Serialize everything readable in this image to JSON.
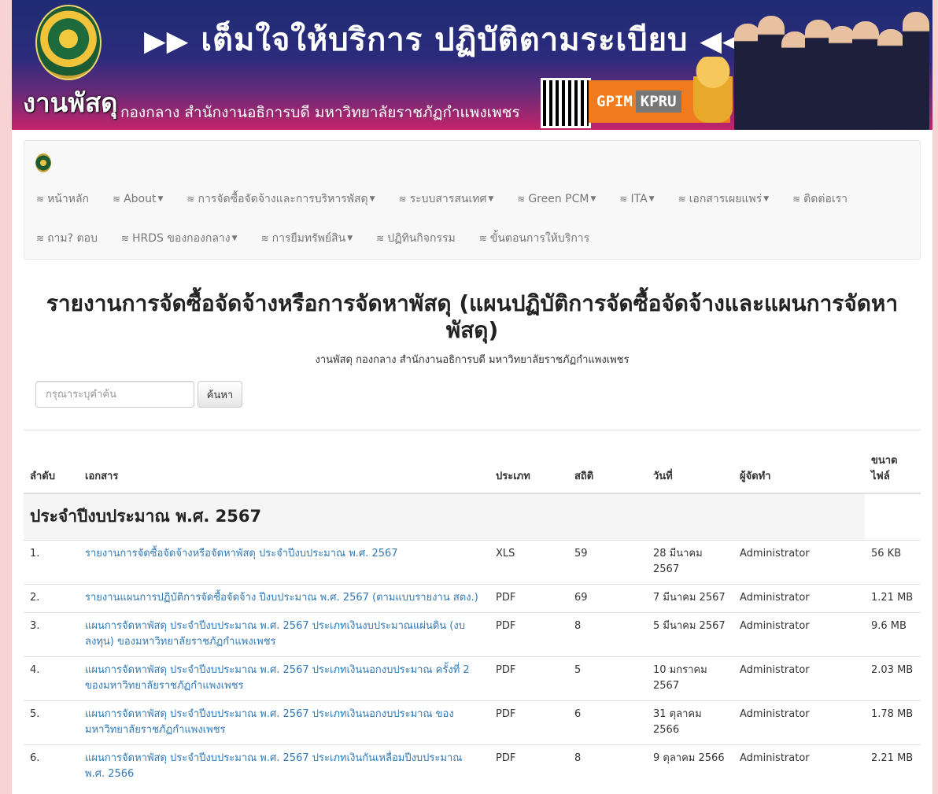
{
  "banner": {
    "slogan": "เต็มใจให้บริการ ปฏิบัติตามระเบียบ",
    "department": "งานพัสดุ",
    "organization": "กองกลาง สำนักงานอธิการบดี มหาวิทยาลัยราชภัฏกำแพงเพชร",
    "gpim_label": "GPIM",
    "kpru_label": "KPRU"
  },
  "nav": {
    "row1": [
      {
        "label": "หน้าหลัก",
        "dropdown": false
      },
      {
        "label": "About",
        "dropdown": true
      },
      {
        "label": "การจัดซื้อจัดจ้างและการบริหารพัสดุ",
        "dropdown": true
      },
      {
        "label": "ระบบสารสนเทศ",
        "dropdown": true
      },
      {
        "label": "Green PCM",
        "dropdown": true
      },
      {
        "label": "ITA",
        "dropdown": true
      },
      {
        "label": "เอกสารเผยแพร่",
        "dropdown": true
      },
      {
        "label": "ติดต่อเรา",
        "dropdown": false
      }
    ],
    "row2": [
      {
        "label": "ถาม? ตอบ",
        "dropdown": false
      },
      {
        "label": "HRDS ของกองกลาง",
        "dropdown": true
      },
      {
        "label": "การยืมทรัพย์สิน",
        "dropdown": true
      },
      {
        "label": "ปฏิทินกิจกรรม",
        "dropdown": false
      },
      {
        "label": "ขั้นตอนการให้บริการ",
        "dropdown": false
      }
    ]
  },
  "page": {
    "title": "รายงานการจัดซื้อจัดจ้างหรือการจัดหาพัสดุ (แผนปฏิบัติการจัดซื้อจัดจ้างและแผนการจัดหาพัสดุ)",
    "subtitle": "งานพัสดุ กองกลาง สำนักงานอธิการบดี มหาวิทยาลัยราชภัฏกำแพงเพชร"
  },
  "search": {
    "placeholder": "กรุณาระบุคำค้น",
    "button_label": "ค้นหา"
  },
  "table": {
    "headers": {
      "no": "ลำดับ",
      "doc": "เอกสาร",
      "type": "ประเภท",
      "stat": "สถิติ",
      "date": "วันที่",
      "author": "ผู้จัดทำ",
      "size": "ขนาดไฟล์"
    },
    "group_title": "ประจำปีงบประมาณ พ.ศ. 2567",
    "rows": [
      {
        "no": "1.",
        "doc": "รายงานการจัดซื้อจัดจ้างหรือจัดหาพัสดุ ประจำปีงบประมาณ พ.ศ. 2567",
        "type": "XLS",
        "stat": "59",
        "date": "28 มีนาคม 2567",
        "author": "Administrator",
        "size": "56 KB"
      },
      {
        "no": "2.",
        "doc": "รายงานแผนการปฏิบัติการจัดซื้อจัดจ้าง ปีงบประมาณ พ.ศ. 2567 (ตามแบบรายงาน สตง.)",
        "type": "PDF",
        "stat": "69",
        "date": "7 มีนาคม 2567",
        "author": "Administrator",
        "size": "1.21 MB"
      },
      {
        "no": "3.",
        "doc": "แผนการจัดหาพัสดุ ประจำปีงบประมาณ พ.ศ. 2567 ประเภทเงินงบประมาณแผ่นดิน (งบลงทุน) ของมหาวิทยาลัยราชภัฏกำแพงเพชร",
        "type": "PDF",
        "stat": "8",
        "date": "5 มีนาคม 2567",
        "author": "Administrator",
        "size": "9.6 MB"
      },
      {
        "no": "4.",
        "doc": "แผนการจัดหาพัสดุ ประจำปีงบประมาณ พ.ศ. 2567 ประเภทเงินนอกงบประมาณ ครั้งที่ 2 ของมหาวิทยาลัยราชภัฏกำแพงเพชร",
        "type": "PDF",
        "stat": "5",
        "date": "10 มกราคม 2567",
        "author": "Administrator",
        "size": "2.03 MB"
      },
      {
        "no": "5.",
        "doc": "แผนการจัดหาพัสดุ ประจำปีงบประมาณ พ.ศ. 2567 ประเภทเงินนอกงบประมาณ ของมหาวิทยาลัยราชภัฏกำแพงเพชร",
        "type": "PDF",
        "stat": "6",
        "date": "31 ตุลาคม 2566",
        "author": "Administrator",
        "size": "1.78 MB"
      },
      {
        "no": "6.",
        "doc": "แผนการจัดหาพัสดุ ประจำปีงบประมาณ พ.ศ. 2567 ประเภทเงินกันเหลื่อมปีงบประมาณ พ.ศ. 2566",
        "type": "PDF",
        "stat": "8",
        "date": "9 ตุลาคม 2566",
        "author": "Administrator",
        "size": "2.21 MB"
      }
    ]
  }
}
